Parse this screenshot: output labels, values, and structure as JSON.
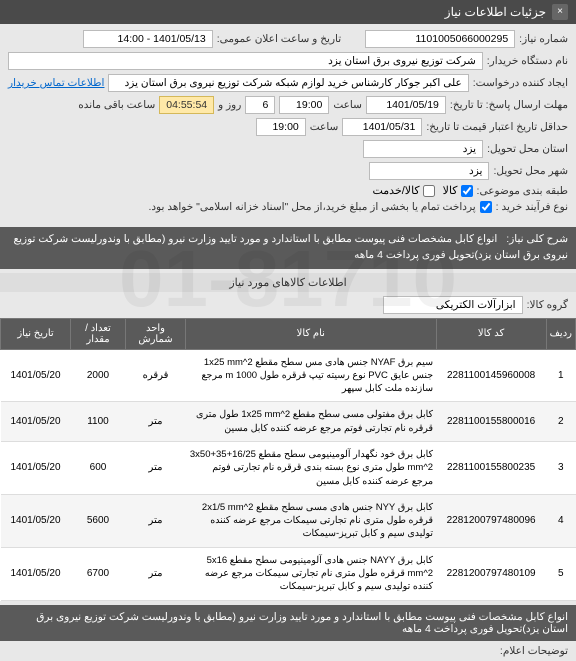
{
  "header": {
    "title": "جزئیات اطلاعات نیاز",
    "close": "×"
  },
  "fields": {
    "need_no_label": "شماره نیاز:",
    "need_no": "1101005066000295",
    "datetime_label": "تاریخ و ساعت اعلان عمومی:",
    "datetime": "1401/05/13 - 14:00",
    "buyer_org_label": "نام دستگاه خریدار:",
    "buyer_org": "شرکت توزیع نیروی برق استان یزد",
    "requester_label": "ایجاد کننده درخواست:",
    "requester": "علی اکبر جوکار  کارشناس خرید لوازم شبکه  شرکت توزیع نیروی برق استان یزد",
    "contact_link": "اطلاعات تماس خریدار",
    "deadline_label": "مهلت ارسال پاسخ: تا تاریخ:",
    "deadline_date": "1401/05/19",
    "time_label": "ساعت",
    "deadline_time": "19:00",
    "countdown": "04:55:54",
    "days": "6",
    "days_label": "روز و",
    "remain_label": "ساعت باقی مانده",
    "validity_label": "حداقل تاریخ اعتبار قیمت تا تاریخ:",
    "validity_date": "1401/05/31",
    "validity_time": "19:00",
    "province_label": "استان محل تحویل:",
    "province": "یزد",
    "city_label": "شهر محل تحویل:",
    "city": "یزد",
    "category_label": "طبقه بندی موضوعی:",
    "cat_goods": "کالا",
    "cat_service": "کالا/خدمت",
    "process_label": "نوع فرآیند خرید :",
    "process_note": "پرداخت تمام یا بخشی از مبلغ خرید،از محل \"اسناد خزانه اسلامی\" خواهد بود."
  },
  "desc": {
    "label": "شرح کلی نیاز:",
    "text": "انواع کابل مشخصات فنی پیوست مطابق با استاندارد و مورد تایید وزارت نیرو (مطابق با وندورلیست شرکت توزیع نیروی برق استان یزد)تحویل فوری پرداخت 4 ماهه"
  },
  "section": {
    "title": "اطلاعات کالاهای مورد نیاز",
    "group_label": "گروه کالا:",
    "group_value": "ابزارآلات الکتریکی"
  },
  "table": {
    "headers": {
      "row": "ردیف",
      "code": "کد کالا",
      "name": "نام کالا",
      "unit": "واحد شمارش",
      "qty": "تعداد / مقدار",
      "date": "تاریخ نیاز"
    },
    "rows": [
      {
        "row": "1",
        "code": "2281100145960008",
        "name": "سیم برق NYAF جنس هادی مس سطح مقطع 1x25 mm^2 جنس عایق PVC نوع رسیته تیپ قرقره طول 1000 m مرجع سازنده ملت کابل سپهر",
        "unit": "قرقره",
        "qty": "2000",
        "date": "1401/05/20"
      },
      {
        "row": "2",
        "code": "2281100155800016",
        "name": "کابل برق مفتولی مسی سطح مقطع 1x25 mm^2 طول متری قرقره نام تجارتی فوتم مرجع عرضه کننده کابل مسین",
        "unit": "متر",
        "qty": "1100",
        "date": "1401/05/20"
      },
      {
        "row": "3",
        "code": "2281100155800235",
        "name": "کابل برق خود نگهدار آلومینیومی سطح مقطع 3x50+35+16/25 mm^2 طول متری نوع بسته بندی قرقره نام تجارتی فوتم مرجع عرضه کننده کابل مسین",
        "unit": "متر",
        "qty": "600",
        "date": "1401/05/20"
      },
      {
        "row": "4",
        "code": "2281200797480096",
        "name": "کابل برق NYY جنس هادی مسی سطح مقطع 2x1/5 mm^2 قرقره طول متری نام تجارتی سیمکات مرجع عرضه کننده تولیدی سیم و کابل تبریز-سیمکات",
        "unit": "متر",
        "qty": "5600",
        "date": "1401/05/20"
      },
      {
        "row": "5",
        "code": "2281200797480109",
        "name": "کابل برق NAYY جنس هادی آلومینیومی سطح مقطع 5x16 mm^2 قرقره طول متری نام تجارتی سیمکات مرجع عرضه کننده تولیدی سیم و کابل تبریز-سیمکات",
        "unit": "متر",
        "qty": "6700",
        "date": "1401/05/20"
      }
    ]
  },
  "footer": {
    "desc": "انواع کابل مشخصات فنی پیوست مطابق با استاندارد و مورد تایید وزارت نیرو (مطابق با وندورلیست شرکت توزیع نیروی برق استان یزد)تحویل فوری پرداخت 4 ماهه",
    "explain_label": "توضیحات اعلام:"
  }
}
